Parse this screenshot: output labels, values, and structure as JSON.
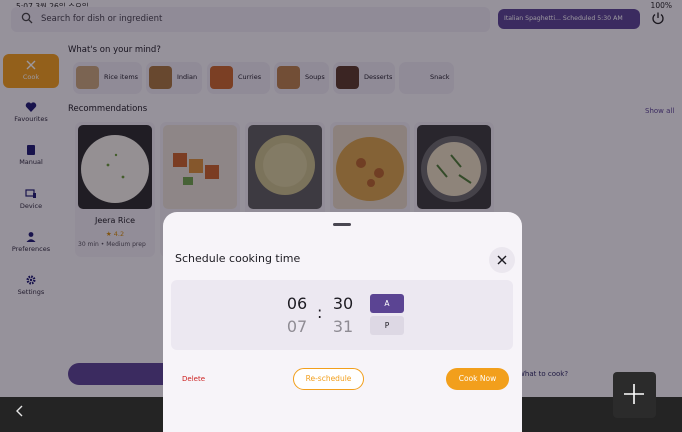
{
  "status_bar": {
    "time_date": "5:07  3월 26일 수요일",
    "right": "100%"
  },
  "search": {
    "placeholder": "Search for dish or ingredient"
  },
  "schedule_chip": {
    "label": "Italian Spaghetti... Scheduled 5:30 AM"
  },
  "sidebar": {
    "items": [
      {
        "label": "Cook",
        "icon": "cook-icon",
        "active": true
      },
      {
        "label": "Favourites",
        "icon": "heart-icon"
      },
      {
        "label": "Manual",
        "icon": "book-icon"
      },
      {
        "label": "Device",
        "icon": "device-icon"
      },
      {
        "label": "Preferences",
        "icon": "person-icon"
      },
      {
        "label": "Settings",
        "icon": "gear-icon"
      }
    ]
  },
  "whats_on_mind": {
    "title": "What's on your mind?",
    "categories": [
      {
        "label": "Rice items"
      },
      {
        "label": "Indian"
      },
      {
        "label": "Curries"
      },
      {
        "label": "Soups"
      },
      {
        "label": "Desserts"
      },
      {
        "label": "Snack"
      }
    ]
  },
  "recommendations": {
    "title": "Recommendations",
    "show_all": "Show all",
    "cards": [
      {
        "name": "Jeera Rice",
        "rating": "★ 4.2",
        "meta": "30 min • Medium prep"
      }
    ]
  },
  "footer": {
    "what_to_cook": "What to cook?"
  },
  "sheet": {
    "title": "Schedule cooking time",
    "hour_selected": "06",
    "hour_next": "07",
    "minute_selected": "30",
    "minute_next": "31",
    "separator": ":",
    "am": "A",
    "pm": "P",
    "delete": "Delete",
    "reschedule": "Re-schedule",
    "cook_now": "Cook Now"
  },
  "colors": {
    "accent": "#f29f1c",
    "primary": "#5b4493",
    "danger": "#cc1f1f"
  }
}
